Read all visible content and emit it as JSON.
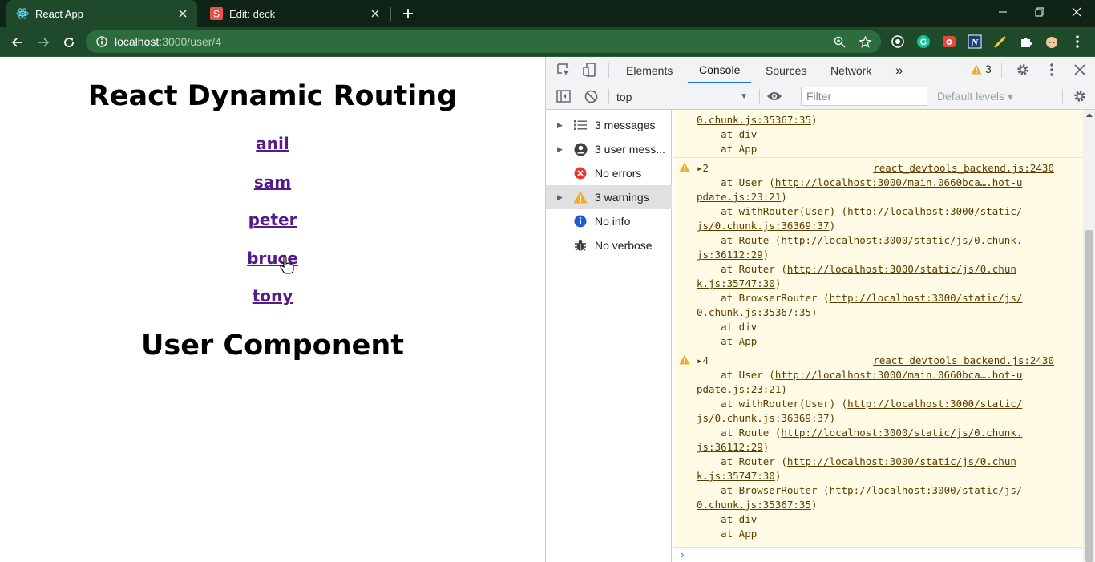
{
  "browser": {
    "tabs": [
      {
        "title": "React App",
        "icon": "react-icon",
        "active": true
      },
      {
        "title": "Edit: deck",
        "icon": "slides-s-icon",
        "active": false
      }
    ],
    "url_host": "localhost",
    "url_path": ":3000/user/4",
    "colors": {
      "frame": "#0f2417",
      "toolbar": "#1e4a2b",
      "omnibox": "#2d6d3d"
    }
  },
  "page": {
    "heading": "React Dynamic Routing",
    "users": [
      "anil",
      "sam",
      "peter",
      "bruce",
      "tony"
    ],
    "subheading": "User Component",
    "link_color": "#551a8b"
  },
  "devtools": {
    "tabs": [
      "Elements",
      "Console",
      "Sources",
      "Network"
    ],
    "more_tabs": "»",
    "selected_tab": "Console",
    "warning_count": "3",
    "context": "top",
    "filter_placeholder": "Filter",
    "levels": "Default levels ▾",
    "sidebar": [
      {
        "label": "3 messages",
        "icon": "list-icon",
        "expandable": true
      },
      {
        "label": "3 user mess...",
        "icon": "user-circle-icon",
        "expandable": true
      },
      {
        "label": "No errors",
        "icon": "error-icon",
        "expandable": false
      },
      {
        "label": "3 warnings",
        "icon": "warning-icon",
        "expandable": true,
        "selected": true
      },
      {
        "label": "No info",
        "icon": "info-icon",
        "expandable": false
      },
      {
        "label": "No verbose",
        "icon": "bug-icon",
        "expandable": false
      }
    ],
    "console": {
      "top_partial": [
        {
          "prefix": "",
          "link": "0.chunk.js:35367:35",
          "suffix": ")"
        },
        {
          "prefix": "    at div",
          "link": "",
          "suffix": ""
        },
        {
          "prefix": "    at App",
          "link": "",
          "suffix": ""
        }
      ],
      "messages": [
        {
          "count": "2",
          "source": "react_devtools_backend.js:2430",
          "lines": [
            {
              "prefix": "    at User (",
              "link": "http://localhost:3000/main.0660bca….hot-u",
              "suffix": ""
            },
            {
              "prefix": "",
              "link": "pdate.js:23:21",
              "suffix": ")"
            },
            {
              "prefix": "    at withRouter(User) (",
              "link": "http://localhost:3000/static/",
              "suffix": ""
            },
            {
              "prefix": "",
              "link": "js/0.chunk.js:36369:37",
              "suffix": ")"
            },
            {
              "prefix": "    at Route (",
              "link": "http://localhost:3000/static/js/0.chunk.",
              "suffix": ""
            },
            {
              "prefix": "",
              "link": "js:36112:29",
              "suffix": ")"
            },
            {
              "prefix": "    at Router (",
              "link": "http://localhost:3000/static/js/0.chun",
              "suffix": ""
            },
            {
              "prefix": "",
              "link": "k.js:35747:30",
              "suffix": ")"
            },
            {
              "prefix": "    at BrowserRouter (",
              "link": "http://localhost:3000/static/js/",
              "suffix": ""
            },
            {
              "prefix": "",
              "link": "0.chunk.js:35367:35",
              "suffix": ")"
            },
            {
              "prefix": "    at div",
              "link": "",
              "suffix": ""
            },
            {
              "prefix": "    at App",
              "link": "",
              "suffix": ""
            }
          ]
        },
        {
          "count": "4",
          "source": "react_devtools_backend.js:2430",
          "lines": [
            {
              "prefix": "    at User (",
              "link": "http://localhost:3000/main.0660bca….hot-u",
              "suffix": ""
            },
            {
              "prefix": "",
              "link": "pdate.js:23:21",
              "suffix": ")"
            },
            {
              "prefix": "    at withRouter(User) (",
              "link": "http://localhost:3000/static/",
              "suffix": ""
            },
            {
              "prefix": "",
              "link": "js/0.chunk.js:36369:37",
              "suffix": ")"
            },
            {
              "prefix": "    at Route (",
              "link": "http://localhost:3000/static/js/0.chunk.",
              "suffix": ""
            },
            {
              "prefix": "",
              "link": "js:36112:29",
              "suffix": ")"
            },
            {
              "prefix": "    at Router (",
              "link": "http://localhost:3000/static/js/0.chun",
              "suffix": ""
            },
            {
              "prefix": "",
              "link": "k.js:35747:30",
              "suffix": ")"
            },
            {
              "prefix": "    at BrowserRouter (",
              "link": "http://localhost:3000/static/js/",
              "suffix": ""
            },
            {
              "prefix": "",
              "link": "0.chunk.js:35367:35",
              "suffix": ")"
            },
            {
              "prefix": "    at div",
              "link": "",
              "suffix": ""
            },
            {
              "prefix": "    at App",
              "link": "",
              "suffix": ""
            }
          ]
        }
      ],
      "prompt": "›",
      "bg_color": "#fffbe5",
      "text_color": "#5c3c00"
    }
  }
}
